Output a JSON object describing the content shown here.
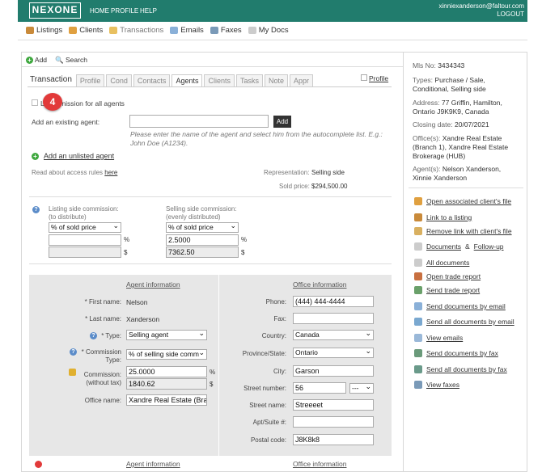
{
  "header": {
    "logo": "NEXONE",
    "nav": [
      "HOME",
      "PROFILE",
      "HELP"
    ],
    "user_email": "xinniexanderson@faltour.com",
    "logout": "LOGOUT"
  },
  "mainnav": [
    {
      "label": "Listings",
      "icon": "house-icon"
    },
    {
      "label": "Clients",
      "icon": "people-icon"
    },
    {
      "label": "Transactions",
      "icon": "folder-icon"
    },
    {
      "label": "Emails",
      "icon": "envelope-icon"
    },
    {
      "label": "Faxes",
      "icon": "fax-icon"
    },
    {
      "label": "My Docs",
      "icon": "document-icon"
    }
  ],
  "toolbar": {
    "add": "Add",
    "search": "Search"
  },
  "tabs": [
    "Transaction",
    "Profile",
    "Cond",
    "Contacts",
    "Agents",
    "Clients",
    "Tasks",
    "Note",
    "Appr"
  ],
  "active_tab": "Agents",
  "profile_link": "Profile",
  "commission_checkbox_label": "L… …mission for all agents",
  "add_existing_label": "Add an existing agent:",
  "add_button": "Add",
  "autocomplete_help": "Please enter the name of the agent and select him from the autocomplete list. E.g.: John Doe (A1234).",
  "add_unlisted": "Add an unlisted agent",
  "access_rules_text": "Read about access rules",
  "access_rules_link": "here",
  "representation_label": "Representation:",
  "representation_value": "Selling side",
  "sold_price_label": "Sold price:",
  "sold_price_value": "$294,500.00",
  "commission": {
    "listing_label": "Listing side commission:",
    "listing_sub": "(to distribute)",
    "listing_type": "% of sold price",
    "listing_pct": "",
    "listing_amt": "",
    "selling_label": "Selling side commission:",
    "selling_sub": "(evenly distributed)",
    "selling_type": "% of sold price",
    "selling_pct": "2.5000",
    "selling_amt": "7362.50",
    "pct_unit": "%",
    "amt_unit": "$"
  },
  "agent_info": {
    "title": "Agent information",
    "first_name_label": "* First name:",
    "first_name": "Nelson",
    "last_name_label": "* Last name:",
    "last_name": "Xanderson",
    "type_label": "* Type:",
    "type_value": "Selling agent",
    "comm_type_label": "* Commission Type:",
    "comm_type_value": "% of selling side comm",
    "commission_label": "Commission:",
    "commission_sub": "(without tax)",
    "commission_pct": "25.0000",
    "commission_amt": "1840.62",
    "office_name_label": "Office name:",
    "office_name": "Xandre Real Estate (Bra"
  },
  "office_info": {
    "title": "Office information",
    "phone_label": "Phone:",
    "phone": "(444) 444-4444",
    "fax_label": "Fax:",
    "fax": "",
    "country_label": "Country:",
    "country": "Canada",
    "province_label": "Province/State:",
    "province": "Ontario",
    "city_label": "City:",
    "city": "Garson",
    "street_number_label": "Street number:",
    "street_number": "56",
    "street_suffix": "---",
    "street_name_label": "Street name:",
    "street_name": "Streeeet",
    "apt_label": "Apt/Suite #:",
    "apt": "",
    "postal_label": "Postal code:",
    "postal": "J8K8k8"
  },
  "second_block": {
    "agent_title": "Agent information",
    "office_title": "Office information"
  },
  "badge": "4",
  "sidebar": {
    "mls_label": "Mls No:",
    "mls": "3434343",
    "types_label": "Types:",
    "types": "Purchase / Sale, Conditional, Selling side",
    "address_label": "Address:",
    "address": "77 Griffin, Hamilton, Ontario J9K9K9, Canada",
    "closing_label": "Closing date:",
    "closing": "20/07/2021",
    "office_label": "Office(s):",
    "office": "Xandre Real Estate (Branch 1), Xandre Real Estate Brokerage (HUB)",
    "agents_label": "Agent(s):",
    "agents": "Nelson Xanderson, Xinnie Xanderson",
    "links": [
      "Open associated client's file",
      "Link to a listing",
      "Remove link with client's file",
      "Documents",
      "Follow-up",
      "All documents",
      "Open trade report",
      "Send trade report",
      "Send documents by email",
      "Send all documents by email",
      "View emails",
      "Send documents by fax",
      "Send all documents by fax",
      "View faxes"
    ],
    "amp": "&"
  },
  "colors": {
    "header": "#217c6d",
    "badge": "#e23a3a"
  }
}
